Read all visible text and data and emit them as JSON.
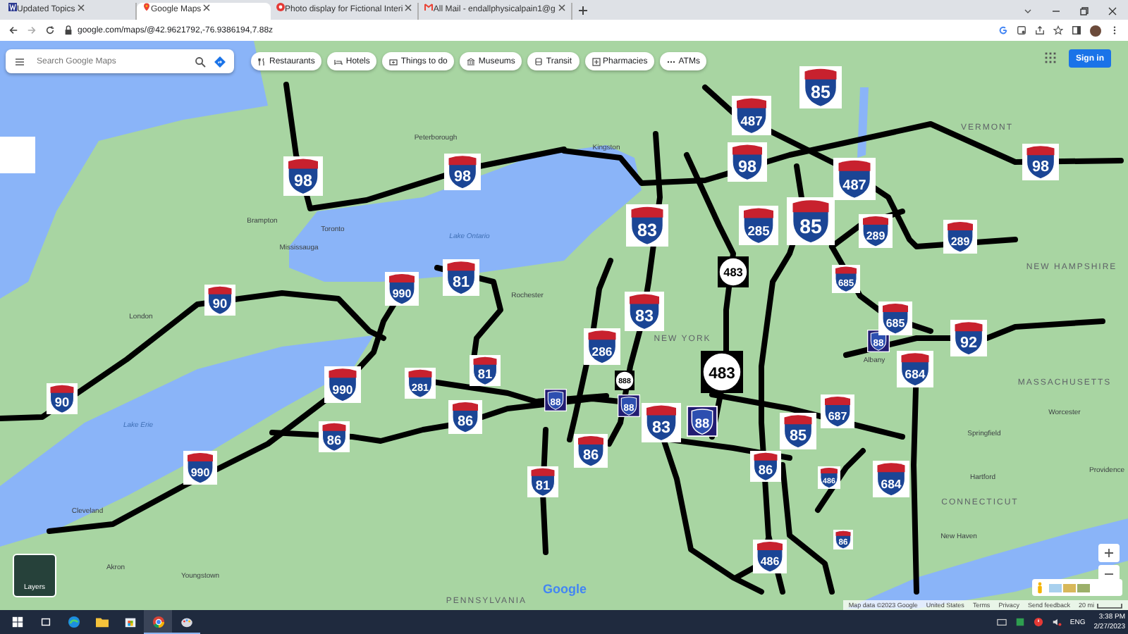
{
  "browser": {
    "tabs": [
      {
        "title": "Updated Topics",
        "selected": false
      },
      {
        "title": "Google Maps",
        "selected": true
      },
      {
        "title": "Photo display for Fictional Interi",
        "selected": false
      },
      {
        "title": "All Mail - endallphysicalpain1@g",
        "selected": false
      }
    ],
    "address": "google.com/maps/@42.9621792,-76.9386194,7.88z"
  },
  "map": {
    "search": {
      "placeholder": "Search Google Maps"
    },
    "chips": [
      "Restaurants",
      "Hotels",
      "Things to do",
      "Museums",
      "Transit",
      "Pharmacies",
      "ATMs"
    ],
    "sign_in": "Sign in",
    "layers_label": "Layers",
    "place_labels": [
      {
        "text": "Toronto",
        "kind": "city"
      },
      {
        "text": "Mississauga",
        "kind": "city"
      },
      {
        "text": "Brampton",
        "kind": "city"
      },
      {
        "text": "Lake Ontario",
        "kind": "water"
      },
      {
        "text": "Kingston",
        "kind": "city"
      },
      {
        "text": "Peterborough",
        "kind": "city"
      },
      {
        "text": "London",
        "kind": "city"
      },
      {
        "text": "Rochester",
        "kind": "city"
      },
      {
        "text": "Lake Erie",
        "kind": "water"
      },
      {
        "text": "NEW YORK",
        "kind": "region"
      },
      {
        "text": "VERMONT",
        "kind": "region"
      },
      {
        "text": "NEW HAMPSHIRE",
        "kind": "region"
      },
      {
        "text": "MASSACHUSETTS",
        "kind": "region"
      },
      {
        "text": "CONNECTICUT",
        "kind": "region"
      },
      {
        "text": "Albany",
        "kind": "city"
      },
      {
        "text": "Springfield",
        "kind": "city"
      },
      {
        "text": "Worcester",
        "kind": "city"
      },
      {
        "text": "Hartford",
        "kind": "city"
      },
      {
        "text": "Providence",
        "kind": "city"
      },
      {
        "text": "New Haven",
        "kind": "city"
      },
      {
        "text": "Cleveland",
        "kind": "city"
      },
      {
        "text": "Akron",
        "kind": "city"
      },
      {
        "text": "Youngstown",
        "kind": "city"
      },
      {
        "text": "PENNSYLVANIA",
        "kind": "region"
      }
    ],
    "shields": [
      {
        "number": "85",
        "kind": "interstate"
      },
      {
        "number": "487",
        "kind": "interstate"
      },
      {
        "number": "98",
        "kind": "interstate"
      },
      {
        "number": "98",
        "kind": "interstate"
      },
      {
        "number": "98",
        "kind": "interstate"
      },
      {
        "number": "487",
        "kind": "interstate"
      },
      {
        "number": "98",
        "kind": "interstate"
      },
      {
        "number": "83",
        "kind": "interstate"
      },
      {
        "number": "285",
        "kind": "interstate"
      },
      {
        "number": "85",
        "kind": "interstate"
      },
      {
        "number": "289",
        "kind": "interstate"
      },
      {
        "number": "289",
        "kind": "interstate"
      },
      {
        "number": "90",
        "kind": "interstate"
      },
      {
        "number": "990",
        "kind": "interstate"
      },
      {
        "number": "81",
        "kind": "interstate"
      },
      {
        "number": "483",
        "kind": "state"
      },
      {
        "number": "685",
        "kind": "interstate"
      },
      {
        "number": "286",
        "kind": "interstate"
      },
      {
        "number": "83",
        "kind": "interstate"
      },
      {
        "number": "88",
        "kind": "old"
      },
      {
        "number": "685",
        "kind": "interstate"
      },
      {
        "number": "92",
        "kind": "interstate"
      },
      {
        "number": "990",
        "kind": "interstate"
      },
      {
        "number": "281",
        "kind": "interstate"
      },
      {
        "number": "81",
        "kind": "interstate"
      },
      {
        "number": "888",
        "kind": "state"
      },
      {
        "number": "483",
        "kind": "state"
      },
      {
        "number": "684",
        "kind": "interstate"
      },
      {
        "number": "90",
        "kind": "interstate"
      },
      {
        "number": "86",
        "kind": "interstate"
      },
      {
        "number": "86",
        "kind": "interstate"
      },
      {
        "number": "88",
        "kind": "old"
      },
      {
        "number": "88",
        "kind": "old"
      },
      {
        "number": "83",
        "kind": "interstate"
      },
      {
        "number": "88",
        "kind": "old"
      },
      {
        "number": "85",
        "kind": "interstate"
      },
      {
        "number": "687",
        "kind": "interstate"
      },
      {
        "number": "990",
        "kind": "interstate"
      },
      {
        "number": "81",
        "kind": "interstate"
      },
      {
        "number": "86",
        "kind": "interstate"
      },
      {
        "number": "86",
        "kind": "interstate"
      },
      {
        "number": "486",
        "kind": "interstate"
      },
      {
        "number": "684",
        "kind": "interstate"
      },
      {
        "number": "486",
        "kind": "interstate"
      },
      {
        "number": "86",
        "kind": "interstate"
      }
    ],
    "logo": "Google",
    "attribution": [
      "Map data ©2023 Google",
      "United States",
      "Terms",
      "Privacy",
      "Send feedback"
    ],
    "scale": "20 mi"
  },
  "taskbar": {
    "apps": [
      {
        "kind": "edge",
        "selected": false,
        "running": false
      },
      {
        "kind": "explorer",
        "selected": false,
        "running": false
      },
      {
        "kind": "store",
        "selected": false,
        "running": false
      },
      {
        "kind": "chrome",
        "selected": true,
        "running": true
      },
      {
        "kind": "paint",
        "selected": false,
        "running": true
      }
    ],
    "language": "ENG",
    "time": "3:38 PM",
    "date": "2/27/2023"
  }
}
